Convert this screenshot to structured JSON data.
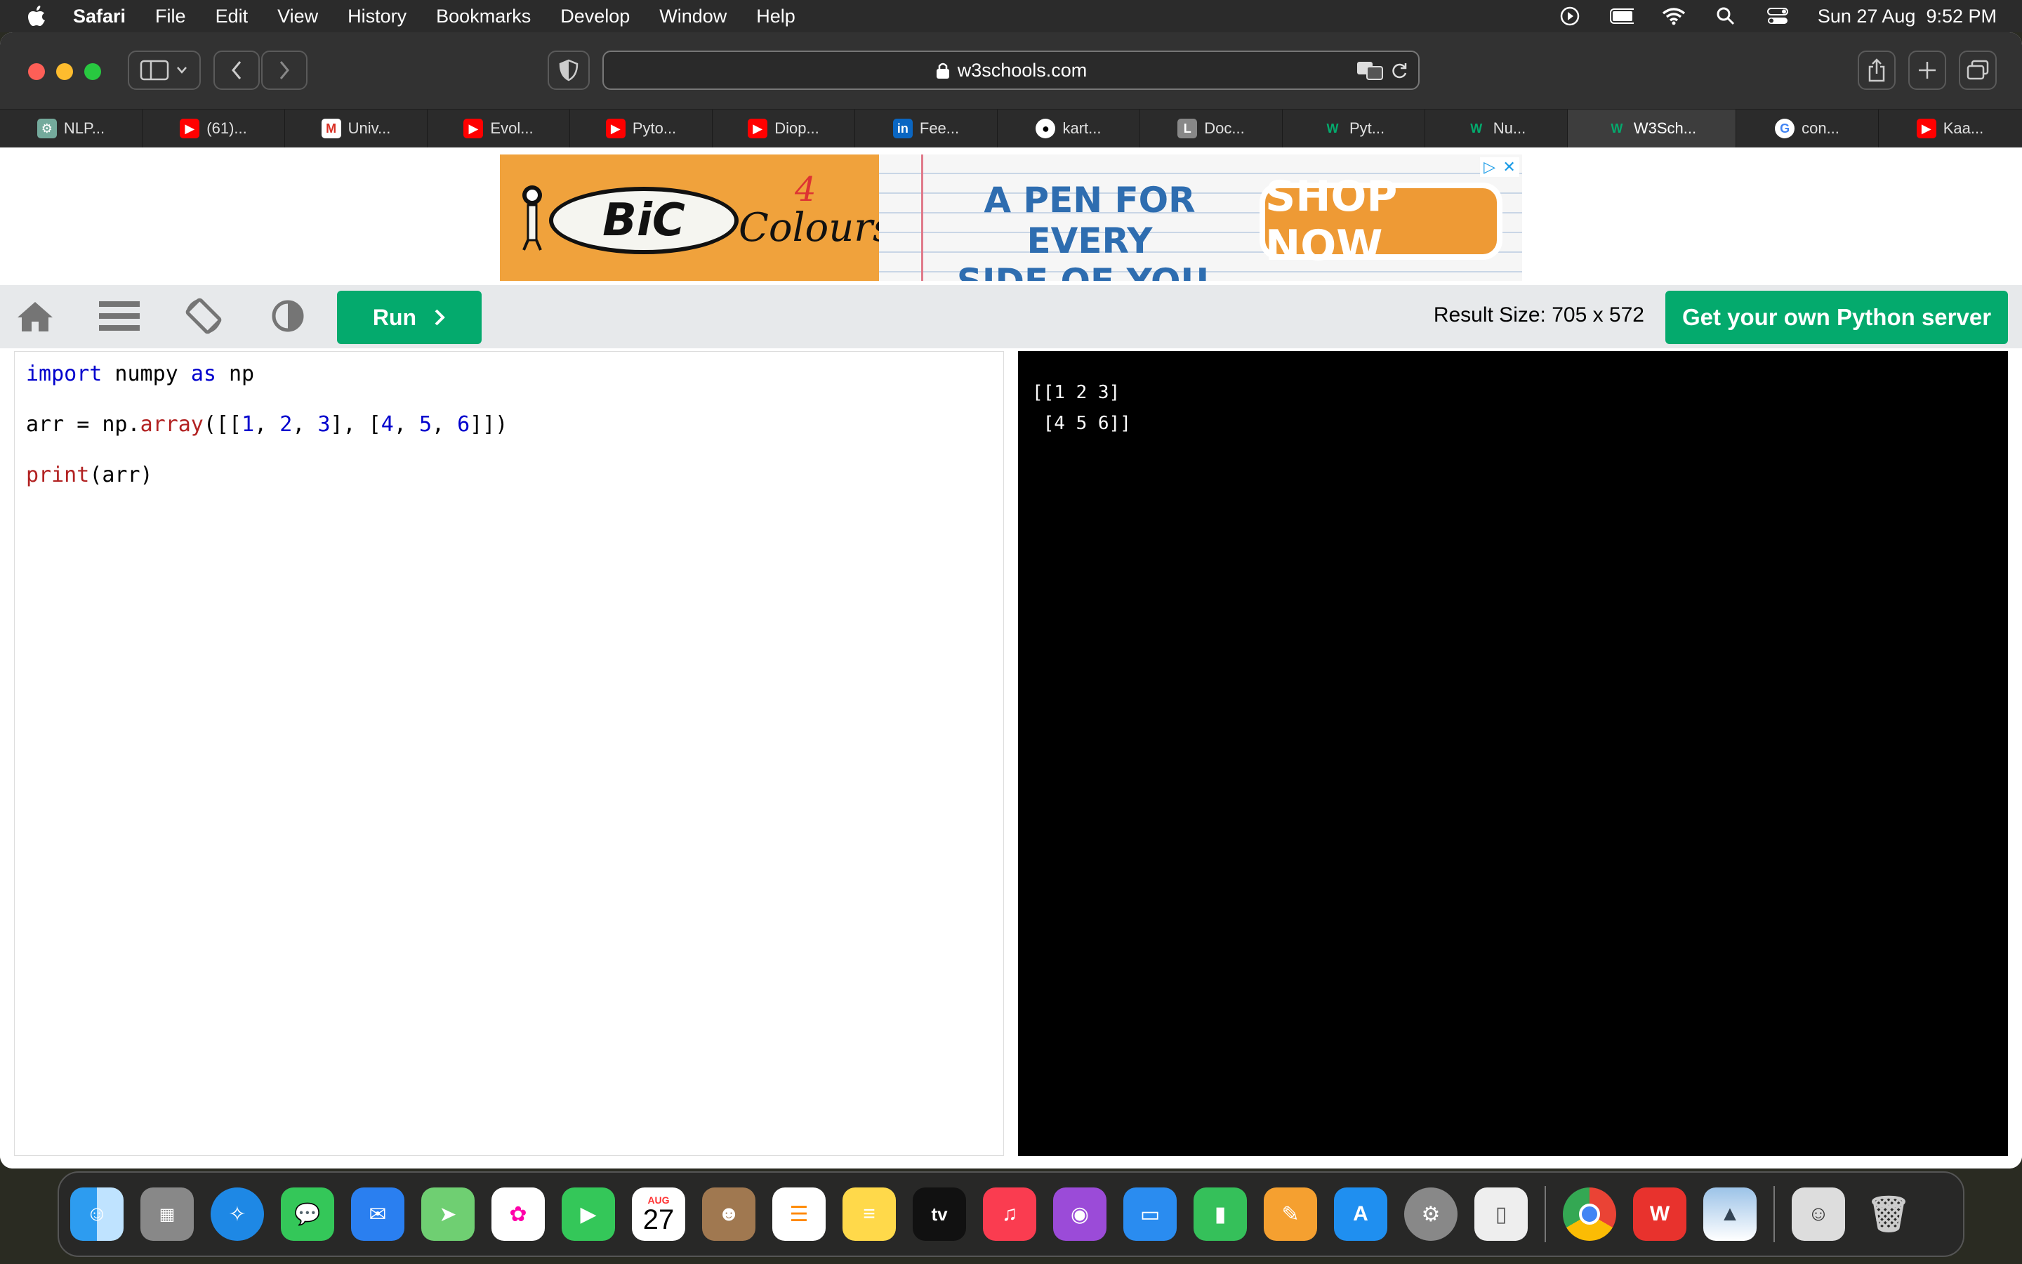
{
  "menubar": {
    "app": "Safari",
    "items": [
      "File",
      "Edit",
      "View",
      "History",
      "Bookmarks",
      "Develop",
      "Window",
      "Help"
    ],
    "datetime": "Sun 27 Aug  9:52 PM"
  },
  "browser": {
    "url": "w3schools.com",
    "tabs": [
      {
        "label": "NLP...",
        "icon": "openai-icon"
      },
      {
        "label": "(61)...",
        "icon": "youtube-icon"
      },
      {
        "label": "Univ...",
        "icon": "gmail-icon"
      },
      {
        "label": "Evol...",
        "icon": "youtube-icon"
      },
      {
        "label": "Pyto...",
        "icon": "youtube-icon"
      },
      {
        "label": "Diop...",
        "icon": "youtube-icon"
      },
      {
        "label": "Fee...",
        "icon": "linkedin-icon"
      },
      {
        "label": "kart...",
        "icon": "github-icon"
      },
      {
        "label": "Doc...",
        "icon": "l-icon"
      },
      {
        "label": "Pyt...",
        "icon": "w3schools-icon"
      },
      {
        "label": "Nu...",
        "icon": "w3schools-icon"
      },
      {
        "label": "W3Sch...",
        "icon": "w3schools-icon"
      },
      {
        "label": "con...",
        "icon": "google-icon"
      },
      {
        "label": "Kaa...",
        "icon": "youtube-icon"
      }
    ],
    "active_tab": 11
  },
  "ad": {
    "brand": "BiC",
    "product_num": "4",
    "product": "Colours",
    "headline_1": "A PEN FOR EVERY",
    "headline_2": "SIDE OF YOU.",
    "cta": "SHOP NOW"
  },
  "w3": {
    "run_label": "Run",
    "result_size": "Result Size: 705 x 572",
    "own_server": "Get your own Python server"
  },
  "code": {
    "line1_kw1": "import",
    "line1_mod": " numpy ",
    "line1_kw2": "as",
    "line1_alias": " np",
    "line2_pre": "arr = np.",
    "line2_fn": "array",
    "line2_a": "([[",
    "n1": "1",
    "n2": "2",
    "n3": "3",
    "n4": "4",
    "n5": "5",
    "n6": "6",
    "comma": ", ",
    "line2_mid": "], [",
    "line2_end": "]])",
    "line3_fn": "print",
    "line3_rest": "(arr)"
  },
  "output": {
    "lines": [
      "[[1 2 3]",
      " [4 5 6]]"
    ]
  },
  "dock": {
    "calendar_month": "AUG",
    "calendar_day": "27",
    "tv": "tv",
    "apps": [
      "Finder",
      "Launchpad",
      "Safari",
      "Messages",
      "Mail",
      "Maps",
      "Photos",
      "FaceTime",
      "Calendar",
      "Contacts",
      "Reminders",
      "Notes",
      "TV",
      "Music",
      "Podcasts",
      "Keynote",
      "Numbers",
      "Pages",
      "App Store",
      "System Settings",
      "Preview",
      "Chrome",
      "WPS",
      "Photo",
      "User",
      "Trash"
    ]
  },
  "colors": {
    "w3_green": "#04aa6d",
    "ad_orange": "#f0a23c"
  }
}
